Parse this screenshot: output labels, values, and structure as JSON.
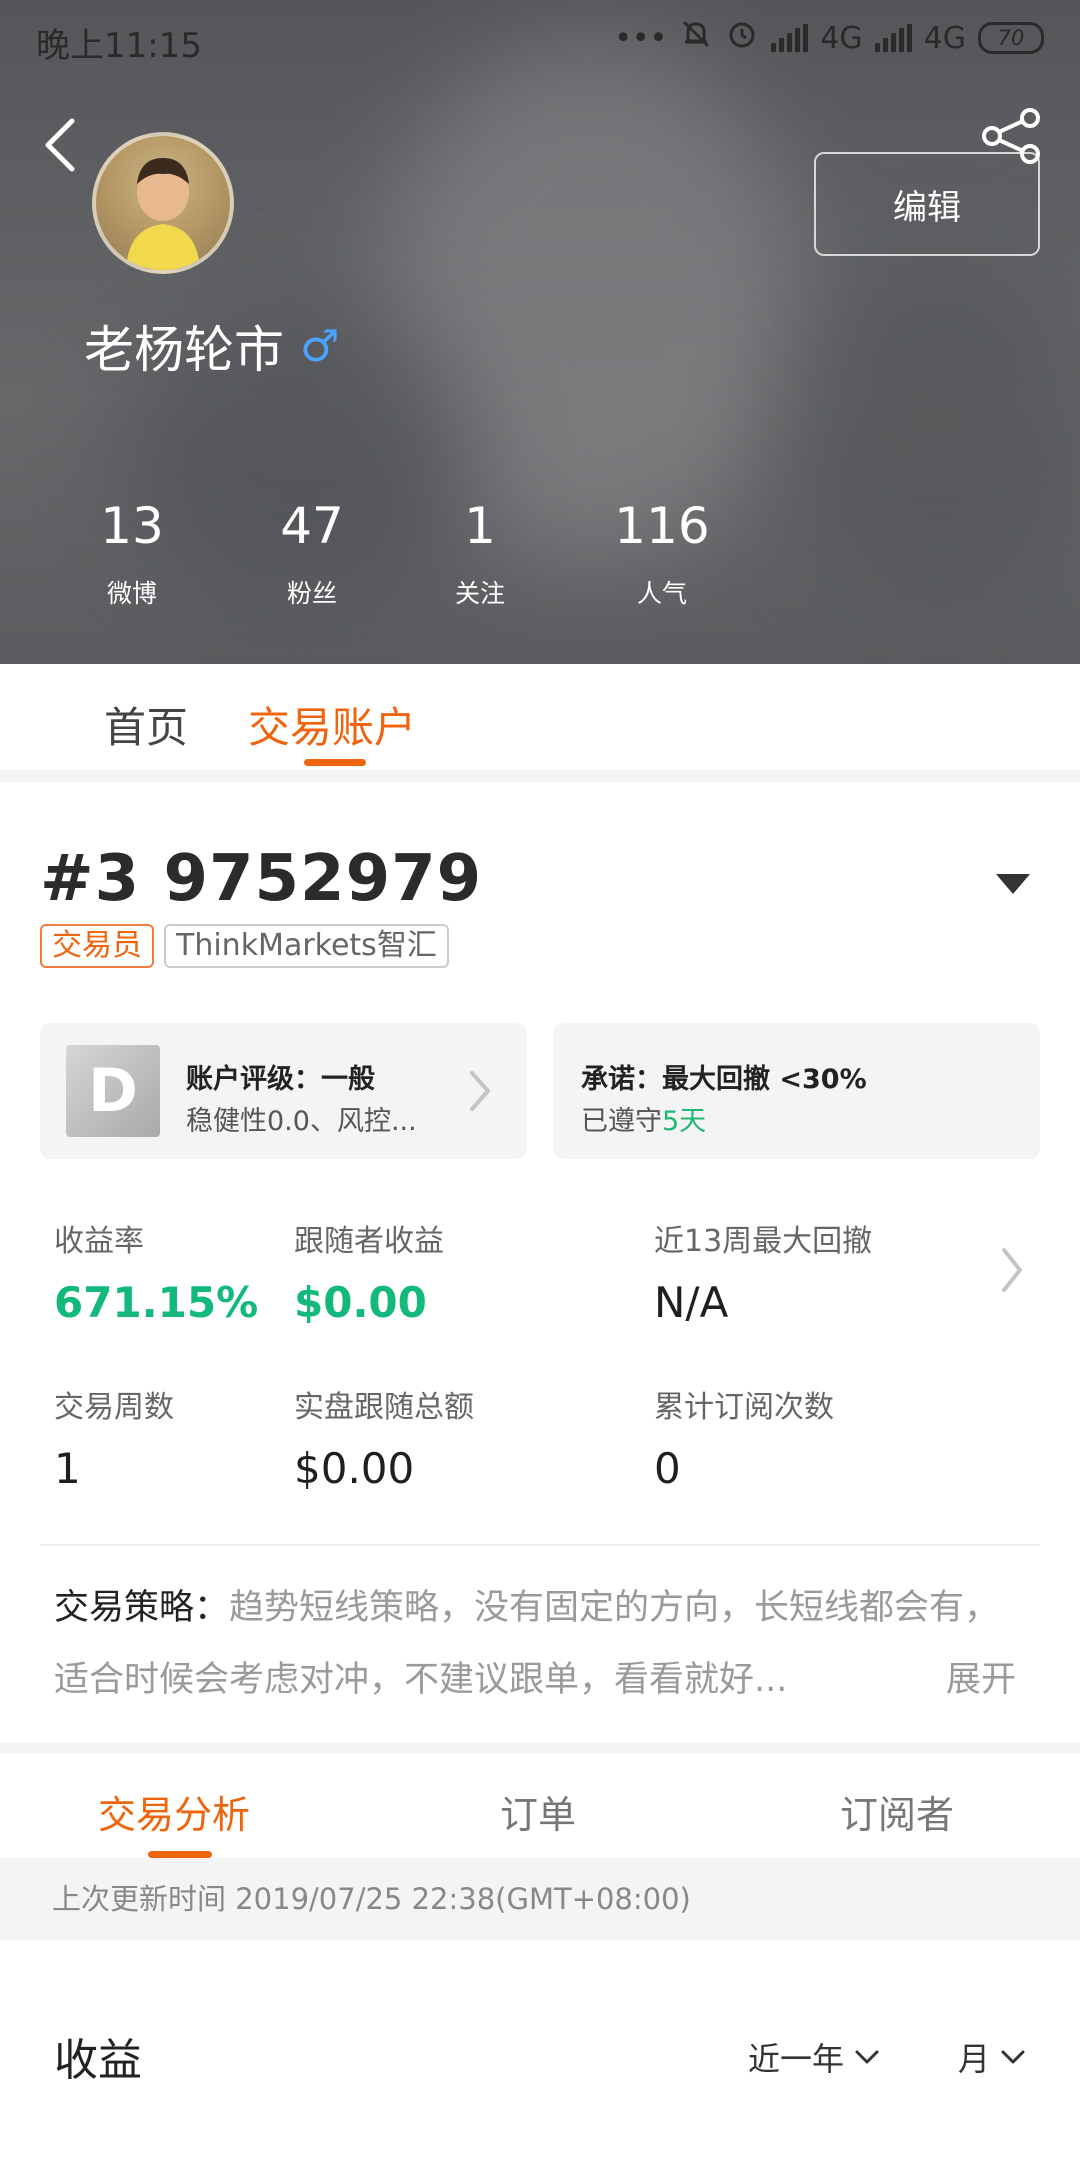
{
  "status_bar": {
    "time": "晚上11:15",
    "network_1": "4G",
    "network_2": "4G",
    "battery": "70"
  },
  "profile": {
    "name": "老杨轮市",
    "gender_symbol": "♂",
    "edit_label": "编辑",
    "stats": [
      {
        "value": "13",
        "label": "微博"
      },
      {
        "value": "47",
        "label": "粉丝"
      },
      {
        "value": "1",
        "label": "关注"
      },
      {
        "value": "116",
        "label": "人气"
      }
    ]
  },
  "main_tabs": [
    {
      "label": "首页",
      "active": false
    },
    {
      "label": "交易账户",
      "active": true
    }
  ],
  "account": {
    "id": "#3 9752979",
    "tags": [
      "交易员",
      "ThinkMarkets智汇"
    ],
    "rating_card": {
      "badge": "D",
      "title": "账户评级：一般",
      "subtitle": "稳健性0.0、风控..."
    },
    "promise_card": {
      "title": "承诺：最大回撤 <30%",
      "subtitle_prefix": "已遵守",
      "subtitle_highlight": "5天"
    },
    "metrics": [
      {
        "label": "收益率",
        "value": "671.15%",
        "highlight": true
      },
      {
        "label": "跟随者收益",
        "value": "$0.00",
        "highlight": true
      },
      {
        "label": "近13周最大回撤",
        "value": "N/A",
        "highlight": false
      },
      {
        "label": "交易周数",
        "value": "1",
        "highlight": false
      },
      {
        "label": "实盘跟随总额",
        "value": "$0.00",
        "highlight": false
      },
      {
        "label": "累计订阅次数",
        "value": "0",
        "highlight": false
      }
    ],
    "strategy_label": "交易策略：",
    "strategy_text": "趋势短线策略，没有固定的方向，长短线都会有，适合时候会考虑对冲，不建议跟单，看看就好...",
    "strategy_more": "展开"
  },
  "analysis_tabs": [
    {
      "label": "交易分析",
      "active": true
    },
    {
      "label": "订单",
      "active": false
    },
    {
      "label": "订阅者",
      "active": false
    }
  ],
  "last_update": "上次更新时间 2019/07/25 22:38(GMT+08:00)",
  "revenue": {
    "title": "收益",
    "range_filter": "近一年",
    "period_filter": "月"
  },
  "colors": {
    "accent": "#f0640e",
    "positive": "#12b97a",
    "gender": "#4aa3ff"
  }
}
